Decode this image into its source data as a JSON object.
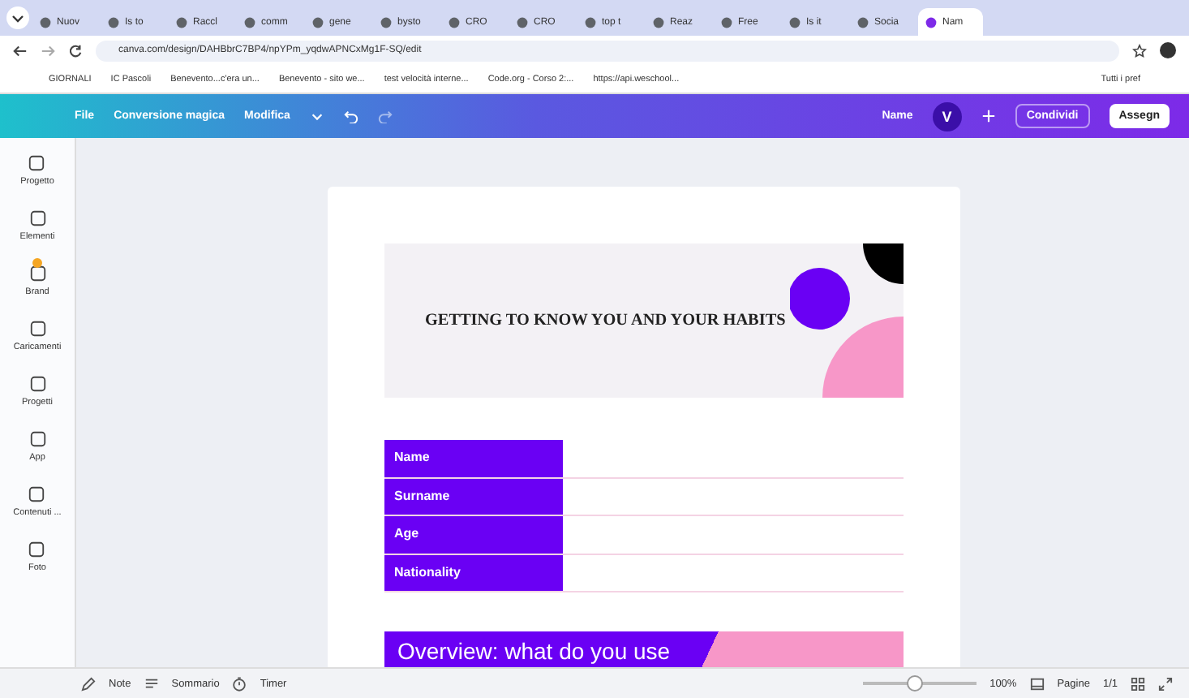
{
  "browser": {
    "tabs": [
      {
        "title": "Nuov",
        "selected": false
      },
      {
        "title": "Is to",
        "selected": false
      },
      {
        "title": "Raccl",
        "selected": false
      },
      {
        "title": "comm",
        "selected": false
      },
      {
        "title": "gene",
        "selected": false
      },
      {
        "title": "bysto",
        "selected": false
      },
      {
        "title": "CRO",
        "selected": false
      },
      {
        "title": "CRO",
        "selected": false
      },
      {
        "title": "top t",
        "selected": false
      },
      {
        "title": "Reaz",
        "selected": false
      },
      {
        "title": "Free",
        "selected": false
      },
      {
        "title": "Is it",
        "selected": false
      },
      {
        "title": "Socia",
        "selected": false
      },
      {
        "title": "Nam",
        "selected": true
      }
    ],
    "url": "canva.com/design/DAHBbrC7BP4/npYPm_yqdwAPNCxMg1F-SQ/edit",
    "bookmarks": [
      "GIORNALI",
      "IC Pascoli",
      "Benevento...c'era un...",
      "Benevento - sito we...",
      "test velocità interne...",
      "Code.org - Corso 2:...",
      "https://api.weschool..."
    ],
    "all_bookmarks": "Tutti i pref"
  },
  "toolbar": {
    "file": "File",
    "magic": "Conversione magica",
    "edit": "Modifica",
    "name": "Name",
    "avatar": "V",
    "share": "Condividi",
    "assign": "Assegn"
  },
  "sidebar": [
    {
      "label": "Progetto",
      "badge": false
    },
    {
      "label": "Elementi",
      "badge": false
    },
    {
      "label": "Brand",
      "badge": true
    },
    {
      "label": "Caricamenti",
      "badge": false
    },
    {
      "label": "Progetti",
      "badge": false
    },
    {
      "label": "App",
      "badge": false
    },
    {
      "label": "Contenuti ...",
      "badge": false
    },
    {
      "label": "Foto",
      "badge": false
    }
  ],
  "design": {
    "title": "GETTING TO KNOW YOU AND YOUR HABITS",
    "rows": [
      "Name",
      "Surname",
      "Age",
      "Nationality"
    ],
    "overview": "Overview: what do you use"
  },
  "footer": {
    "notes": "Note",
    "summary": "Sommario",
    "timer": "Timer",
    "zoom_slider": {
      "level": 0.45
    },
    "zoom": "100%",
    "pages": "Pagine",
    "page_count": "1/1"
  }
}
